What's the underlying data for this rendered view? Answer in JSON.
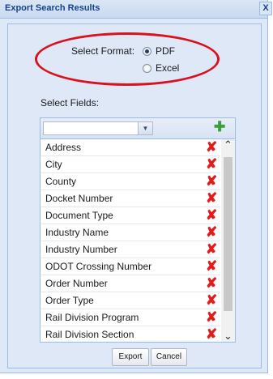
{
  "dialog": {
    "title": "Export Search Results",
    "close_label": "X"
  },
  "format": {
    "label": "Select Format:",
    "options": [
      {
        "label": "PDF",
        "checked": true
      },
      {
        "label": "Excel",
        "checked": false
      }
    ]
  },
  "fields": {
    "label": "Select Fields:",
    "combo_value": "",
    "combo_button_icon": "chevron-down-icon",
    "add_icon": "plus-icon",
    "delete_icon": "red-x-icon",
    "items": [
      "Address",
      "City",
      "County",
      "Docket Number",
      "Document Type",
      "Industry Name",
      "Industry Number",
      "ODOT Crossing Number",
      "Order Number",
      "Order Type",
      "Rail Division Program",
      "Rail Division Section"
    ]
  },
  "buttons": {
    "export": "Export",
    "cancel": "Cancel"
  },
  "colors": {
    "annotation_oval": "#d9121f",
    "delete_x": "#e21b1b",
    "add_plus": "#39a13a"
  }
}
